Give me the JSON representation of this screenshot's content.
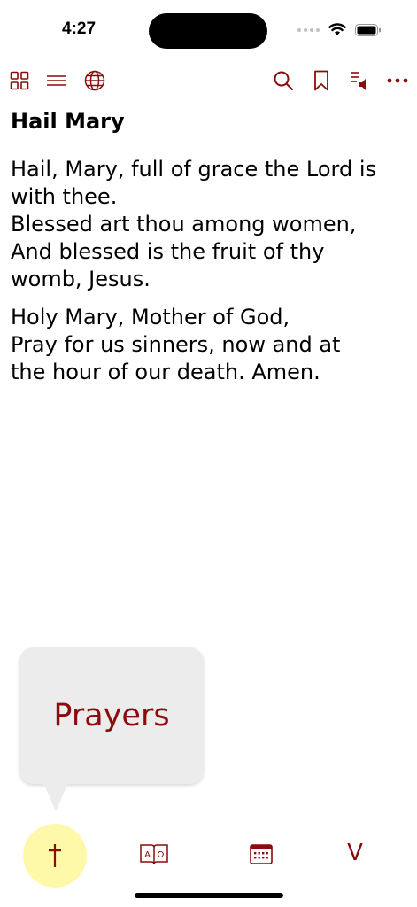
{
  "status_bar": {
    "time": "4:27"
  },
  "toolbar": {
    "left_icons": [
      "grid-icon",
      "list-icon",
      "globe-icon"
    ],
    "right_icons": [
      "search-icon",
      "bookmark-icon",
      "audio-playlist-icon",
      "more-icon"
    ]
  },
  "prayer": {
    "title": "Hail Mary",
    "stanzas": [
      "Hail, Mary, full of grace the Lord is\nwith thee.\nBlessed art thou among women,\nAnd blessed is the fruit of thy\nwomb, Jesus.",
      "Holy Mary, Mother of God,\nPray for us sinners, now and at\nthe hour of our death. Amen."
    ]
  },
  "tooltip": {
    "text": "Prayers"
  },
  "tabbar": {
    "tabs": [
      {
        "icon": "cross-icon",
        "selected": true
      },
      {
        "icon": "alpha-omega-book-icon",
        "selected": false
      },
      {
        "icon": "calendar-icon",
        "selected": false
      },
      {
        "icon": "v-letter-icon",
        "label": "V",
        "selected": false
      }
    ]
  },
  "colors": {
    "accent": "#8a0c0c",
    "selected_tab_bg": "#fef9a8",
    "tooltip_bg": "#ececec"
  }
}
